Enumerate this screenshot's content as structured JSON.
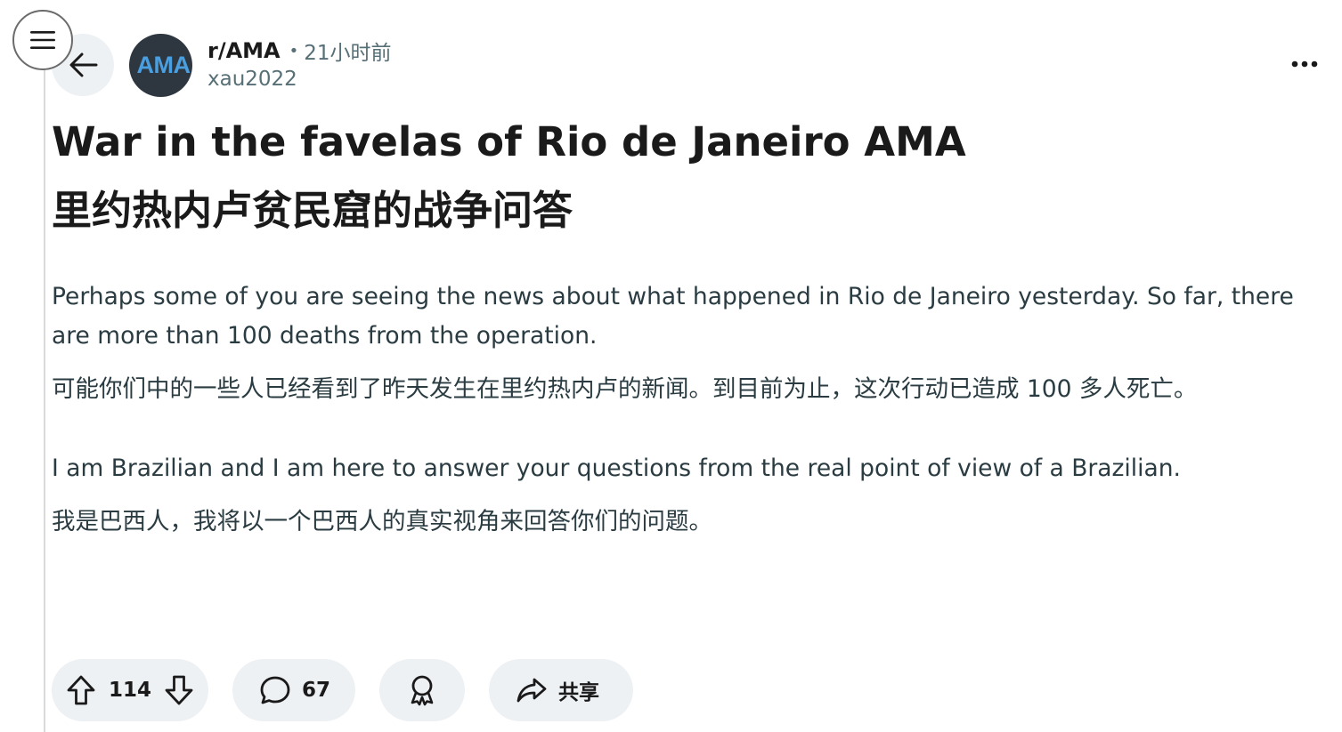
{
  "header": {
    "subreddit": "r/AMA",
    "separator": "•",
    "time_ago": "21小时前",
    "author": "xau2022",
    "avatar_text": "AMA"
  },
  "post": {
    "title_en": "War in the favelas of Rio de Janeiro AMA",
    "title_zh": "里约热内卢贫民窟的战争问答",
    "paragraphs": [
      {
        "en": "Perhaps some of you are seeing the news about what happened in Rio de Janeiro yesterday. So far, there are more than 100 deaths from the operation.",
        "zh": "可能你们中的一些人已经看到了昨天发生在里约热内卢的新闻。到目前为止，这次行动已造成 100 多人死亡。"
      },
      {
        "en": "I am Brazilian and I am here to answer your questions from the real point of view of a Brazilian.",
        "zh": "我是巴西人，我将以一个巴西人的真实视角来回答你们的问题。"
      }
    ]
  },
  "actions": {
    "upvotes": "114",
    "comments": "67",
    "share_label": "共享"
  },
  "icons": {
    "menu": "hamburger-menu-icon",
    "back": "arrow-left-icon",
    "more": "more-horizontal-icon",
    "upvote": "arrow-up-outline-icon",
    "downvote": "arrow-down-outline-icon",
    "comment": "speech-bubble-icon",
    "award": "award-ribbon-icon",
    "share": "share-arrow-icon"
  },
  "colors": {
    "pill_background": "#eef1f3",
    "meta_text": "#576f76",
    "avatar_background": "#2e3640",
    "avatar_text": "#4a9fe0"
  }
}
